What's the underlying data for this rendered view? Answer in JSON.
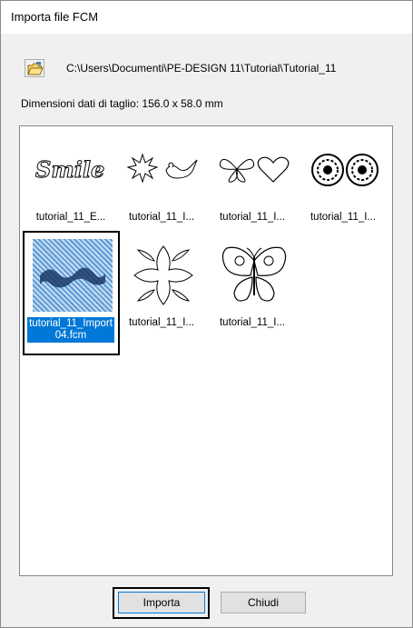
{
  "window": {
    "title": "Importa file FCM"
  },
  "toolbar": {
    "folder_icon": "open-folder-icon"
  },
  "path": "C:\\Users\\Documenti\\PE-DESIGN 11\\Tutorial\\Tutorial_11",
  "dimensions": "Dimensioni dati di taglio:   156.0 x 58.0 mm",
  "files": [
    {
      "label": "tutorial_11_E...",
      "icon": "smile-script-icon"
    },
    {
      "label": "tutorial_11_I...",
      "icon": "burst-bird-icon"
    },
    {
      "label": "tutorial_11_I...",
      "icon": "bow-heart-icon"
    },
    {
      "label": "tutorial_11_I...",
      "icon": "mandala-icon"
    },
    {
      "label": "tutorial_11_Import04.fcm",
      "icon": "lace-band-icon",
      "selected": true
    },
    {
      "label": "tutorial_11_I...",
      "icon": "leaf-cross-icon"
    },
    {
      "label": "tutorial_11_I...",
      "icon": "butterfly-icon"
    }
  ],
  "buttons": {
    "import": "Importa",
    "close": "Chiudi"
  },
  "colors": {
    "selection": "#0078d7",
    "accent_border": "#0078d7"
  }
}
